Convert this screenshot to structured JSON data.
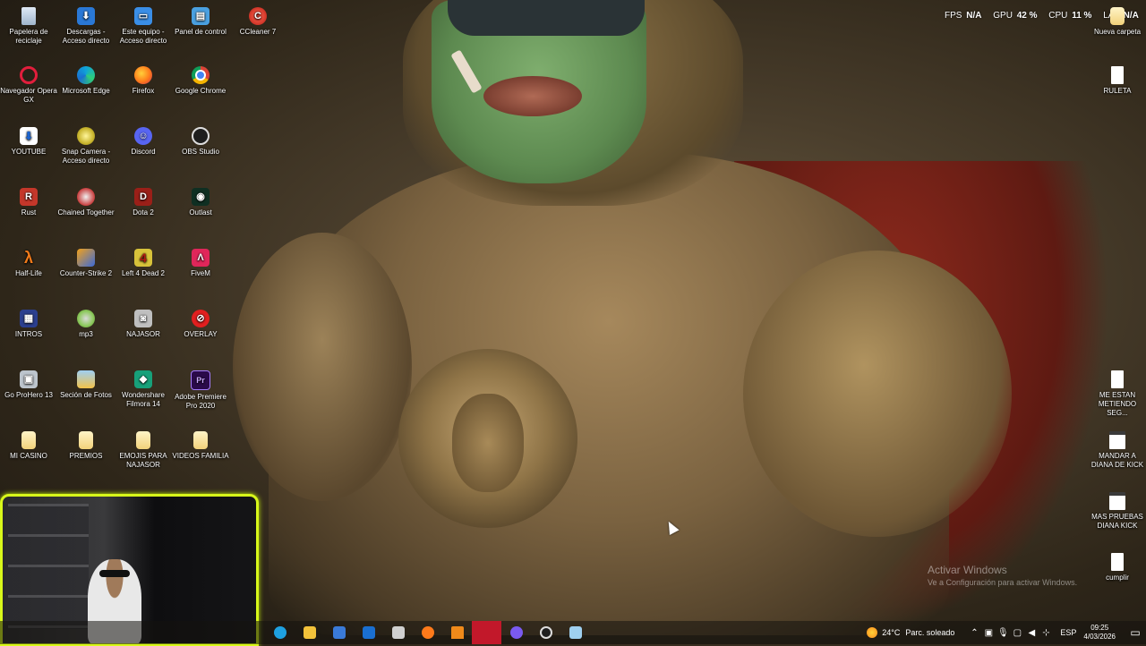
{
  "hud": {
    "fps_label": "FPS",
    "fps_value": "N/A",
    "gpu_label": "GPU",
    "gpu_value": "42 %",
    "cpu_label": "CPU",
    "cpu_value": "11 %",
    "lat_label": "LAT",
    "lat_value": "N/A"
  },
  "desktop": {
    "icons_left": [
      {
        "label": "Papelera de reciclaje",
        "icon": "recycle-bin-icon"
      },
      {
        "label": "Descargas - Acceso directo",
        "icon": "downloads-icon"
      },
      {
        "label": "Este equipo - Acceso directo",
        "icon": "this-pc-icon"
      },
      {
        "label": "Panel de control",
        "icon": "control-panel-icon"
      },
      {
        "label": "CCleaner 7",
        "icon": "ccleaner-icon"
      },
      {
        "label": "Navegador Opera GX",
        "icon": "opera-gx-icon"
      },
      {
        "label": "Microsoft Edge",
        "icon": "edge-icon"
      },
      {
        "label": "Firefox",
        "icon": "firefox-icon"
      },
      {
        "label": "Google Chrome",
        "icon": "chrome-icon"
      },
      {
        "label": "YOUTUBE",
        "icon": "youtube-downloader-icon"
      },
      {
        "label": "Snap Camera - Acceso directo",
        "icon": "snap-camera-icon"
      },
      {
        "label": "Discord",
        "icon": "discord-icon"
      },
      {
        "label": "OBS Studio",
        "icon": "obs-icon"
      },
      {
        "label": "Rust",
        "icon": "rust-icon"
      },
      {
        "label": "Chained Together",
        "icon": "chained-together-icon"
      },
      {
        "label": "Dota 2",
        "icon": "dota-icon"
      },
      {
        "label": "Outlast",
        "icon": "outlast-icon"
      },
      {
        "label": "Half-Life",
        "icon": "half-life-icon"
      },
      {
        "label": "Counter-Strike 2",
        "icon": "counter-strike-icon"
      },
      {
        "label": "Left 4 Dead 2",
        "icon": "left4dead-icon"
      },
      {
        "label": "FiveM",
        "icon": "fivem-icon"
      },
      {
        "label": "INTROS",
        "icon": "intros-icon"
      },
      {
        "label": "mp3",
        "icon": "mp3-icon"
      },
      {
        "label": "NAJASOR",
        "icon": "camera-icon"
      },
      {
        "label": "OVERLAY",
        "icon": "overlay-icon"
      },
      {
        "label": "Go ProHero 13",
        "icon": "gopro-icon"
      },
      {
        "label": "Seción de Fotos",
        "icon": "photos-icon"
      },
      {
        "label": "Wondershare Filmora 14",
        "icon": "filmora-icon"
      },
      {
        "label": "Adobe Premiere Pro 2020",
        "icon": "premiere-icon"
      },
      {
        "label": "MI CASINO",
        "icon": "folder-icon"
      },
      {
        "label": "PREMIOS",
        "icon": "folder-icon"
      },
      {
        "label": "EMOJIS PARA NAJASOR",
        "icon": "folder-icon"
      },
      {
        "label": "VIDEOS FAMILIA",
        "icon": "folder-icon"
      }
    ],
    "icons_right": [
      {
        "label": "Nueva carpeta",
        "icon": "folder-icon"
      },
      {
        "label": "RULETA",
        "icon": "text-file-icon"
      },
      {
        "label": "ME ESTAN METIENDO SEG...",
        "icon": "text-file-icon"
      },
      {
        "label": "MANDAR A DIANA DE KICK",
        "icon": "notepad-icon"
      },
      {
        "label": "MAS PRUEBAS DIANA KICK",
        "icon": "notepad-icon"
      },
      {
        "label": "cumplir",
        "icon": "text-file-icon"
      }
    ]
  },
  "watermark": {
    "title": "Activar Windows",
    "subtitle": "Ve a Configuración para activar Windows."
  },
  "taskbar": {
    "apps": [
      {
        "name": "edge",
        "color": "#1ea0e0"
      },
      {
        "name": "file-explorer",
        "color": "#f2c23a"
      },
      {
        "name": "microsoft-store",
        "color": "#3a7ad8"
      },
      {
        "name": "outlook",
        "color": "#1a6fd1"
      },
      {
        "name": "chat",
        "color": "#d0d0d0"
      },
      {
        "name": "firefox",
        "color": "#ff7a1a"
      },
      {
        "name": "vlc",
        "color": "#f08a1a"
      },
      {
        "name": "recording",
        "color": "#c2182a"
      },
      {
        "name": "discord-red",
        "color": "#7a5af0"
      },
      {
        "name": "obs",
        "color": "#dddddd"
      },
      {
        "name": "notepad",
        "color": "#9fd0f0"
      }
    ],
    "weather": {
      "temp": "24°C",
      "condition": "Parc. soleado"
    },
    "language": "ESP",
    "time": "09:25",
    "date": "4/03/2026"
  }
}
